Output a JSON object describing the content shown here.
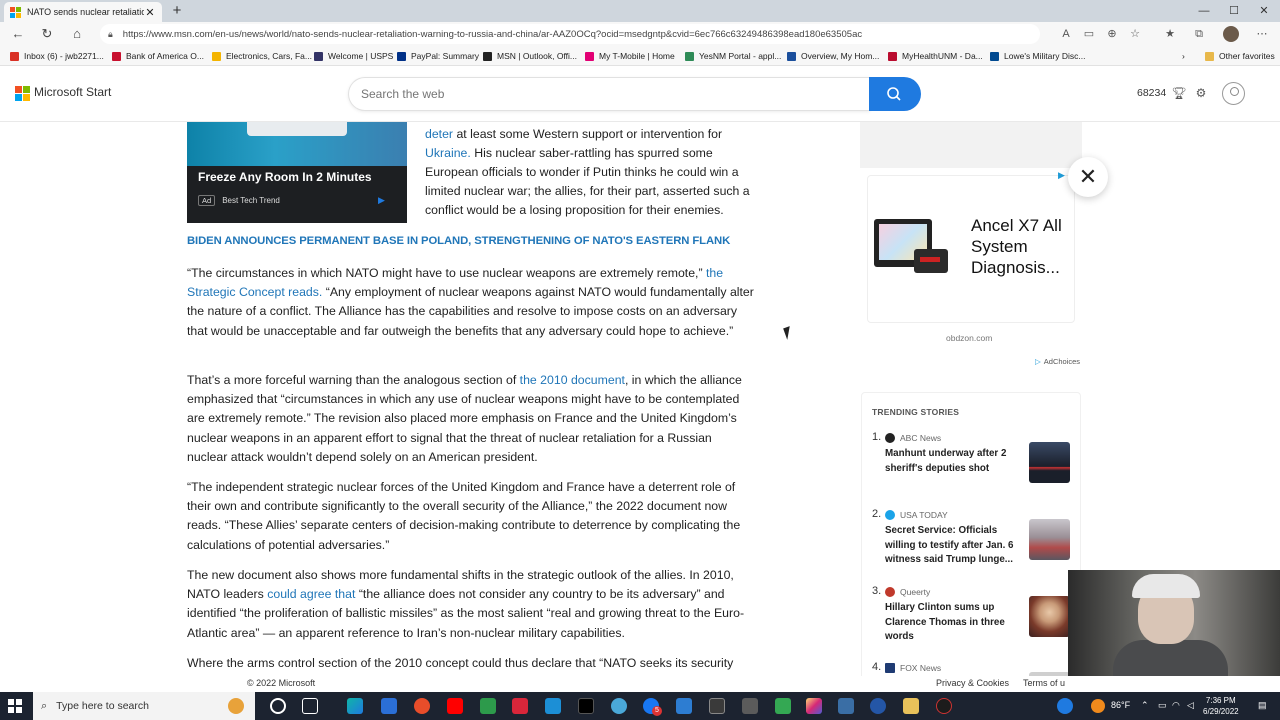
{
  "browser": {
    "tab_title": "NATO sends nuclear retaliation w",
    "tab_close": "✕",
    "new_tab": "+",
    "url": "https://www.msn.com/en-us/news/world/nato-sends-nuclear-retaliation-warning-to-russia-and-china/ar-AAZ0OCq?ocid=msedgntp&cvid=6ec766c63249486398ead180e63505ac",
    "window_controls": [
      "—",
      "☐",
      "✕"
    ],
    "favorites": [
      {
        "label": "Inbox (6) - jwb2271...",
        "color": "#d93025"
      },
      {
        "label": "Bank of America O...",
        "color": "#c8102e"
      },
      {
        "label": "Electronics, Cars, Fa...",
        "color": "#f4b400"
      },
      {
        "label": "Welcome | USPS",
        "color": "#333366"
      },
      {
        "label": "PayPal: Summary",
        "color": "#003087"
      },
      {
        "label": "MSN | Outlook, Offi...",
        "color": "#222222"
      },
      {
        "label": "My T-Mobile | Home",
        "color": "#e20074"
      },
      {
        "label": "YesNM Portal - appl...",
        "color": "#2e8b57"
      },
      {
        "label": "Overview, My Hom...",
        "color": "#1b4f9c"
      },
      {
        "label": "MyHealthUNM - Da...",
        "color": "#ba0c2f"
      },
      {
        "label": "Lowe's Military Disc...",
        "color": "#004990"
      }
    ],
    "other_favorites": "Other favorites"
  },
  "msn": {
    "brand": "Microsoft Start",
    "search_placeholder": "Search the web",
    "points": "68234"
  },
  "article": {
    "ad_title": "Freeze Any Room In 2 Minutes",
    "ad_badge": "Ad",
    "ad_sponsor": "Best Tech Trend",
    "intro_link1": "deter",
    "intro_text1": " at least some Western support or intervention for ",
    "intro_link2": "Ukraine.",
    "intro_text2": " His nuclear saber-rattling has spurred some European officials to wonder if Putin thinks he could win a limited nuclear war; the allies, for their part, asserted such a conflict would be a losing proposition for their enemies.",
    "section_link": "BIDEN ANNOUNCES PERMANENT BASE IN POLAND, STRENGTHENING OF NATO'S EASTERN FLANK",
    "p1_a": "“The circumstances in which NATO might have to use nuclear weapons are extremely remote,” ",
    "p1_link": "the Strategic Concept reads.",
    "p1_b": " “Any employment of nuclear weapons against NATO would fundamentally alter the nature of a conflict. The Alliance has the capabilities and resolve to impose costs on an adversary that would be unacceptable and far outweigh the benefits that any adversary could hope to achieve.”",
    "p2_a": "That’s a more forceful warning than the analogous section of ",
    "p2_link": "the 2010 document",
    "p2_b": ", in which the alliance emphasized that “circumstances in which any use of nuclear weapons might have to be contemplated are extremely remote.” The revision also placed more emphasis on France and the United Kingdom’s nuclear weapons in an apparent effort to signal that the threat of nuclear retaliation for a Russian nuclear attack wouldn’t depend solely on an American president.",
    "p3": "“The independent strategic nuclear forces of the United Kingdom and France have a deterrent role of their own and contribute significantly to the overall security of the Alliance,” the 2022 document now reads. “These Allies’ separate centers of decision-making contribute to deterrence by complicating the calculations of potential adversaries.”",
    "p4_a": "The new document also shows more fundamental shifts in the strategic outlook of the allies. In 2010, NATO leaders ",
    "p4_link": "could agree that",
    "p4_b": " “the alliance does not consider any country to be its adversary” and identified “the proliferation of ballistic missiles” as the most salient “real and growing threat to the Euro-Atlantic area” — an apparent reference to Iran’s non-nuclear military capabilities.",
    "p5": "Where the arms control section of the 2010 concept could thus declare that “NATO seeks its security"
  },
  "rail": {
    "ad_title": "Ancel X7 All System Diagnosis...",
    "ad_domain": "obdzon.com",
    "adchoices": "AdChoices",
    "close": "✕",
    "trending_title": "TRENDING STORIES",
    "stories": [
      {
        "num": "1.",
        "source": "ABC News",
        "title": "Manhunt underway after 2 sheriff's deputies shot",
        "src_color": "#222222",
        "thumb_color": "#2a3140"
      },
      {
        "num": "2.",
        "source": "USA TODAY",
        "title": "Secret Service: Officials willing to testify after Jan. 6 witness said Trump lunge...",
        "src_color": "#1aa3e8",
        "thumb_color": "#8a6f73"
      },
      {
        "num": "3.",
        "source": "Queerty",
        "title": "Hillary Clinton sums up Clarence Thomas in three words",
        "src_color": "#c0392b",
        "thumb_color": "#a5684e"
      },
      {
        "num": "4.",
        "source": "FOX News",
        "title": "",
        "src_color": "#1f3b73",
        "thumb_color": "#cfcfcf"
      }
    ]
  },
  "footer": {
    "copyright": "© 2022 Microsoft",
    "privacy": "Privacy & Cookies",
    "terms": "Terms of u"
  },
  "taskbar": {
    "search": "Type here to search",
    "weather": "86°F",
    "time": "7:36 PM",
    "date": "6/29/2022",
    "badge": "5"
  }
}
